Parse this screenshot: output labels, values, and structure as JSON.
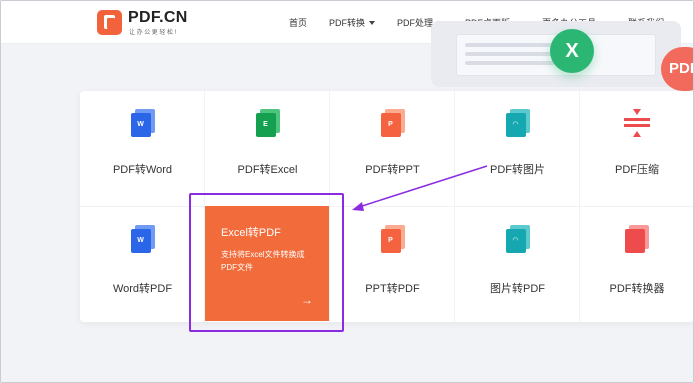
{
  "header": {
    "logo_title": "PDF.CN",
    "logo_subtitle": "让办公更轻松!",
    "nav": [
      {
        "label": "首页",
        "dropdown": false
      },
      {
        "label": "PDF转换",
        "dropdown": true
      },
      {
        "label": "PDF处理",
        "dropdown": true
      },
      {
        "label": "PDF桌面版",
        "dropdown": true
      },
      {
        "label": "更多办公工具",
        "dropdown": true
      },
      {
        "label": "联系我们",
        "dropdown": false
      }
    ]
  },
  "hero": {
    "excel_badge": "X",
    "pdf_badge": "PDF"
  },
  "tools": {
    "row1": [
      {
        "label": "PDF转Word",
        "icon": "word-file-icon",
        "glyph": "W"
      },
      {
        "label": "PDF转Excel",
        "icon": "excel-file-icon",
        "glyph": "E"
      },
      {
        "label": "PDF转PPT",
        "icon": "ppt-file-icon",
        "glyph": "P"
      },
      {
        "label": "PDF转图片",
        "icon": "image-file-icon",
        "glyph": "◠"
      },
      {
        "label": "PDF压缩",
        "icon": "compress-icon",
        "glyph": ""
      }
    ],
    "row2": [
      {
        "label": "Word转PDF",
        "icon": "word-file-icon",
        "glyph": "W"
      },
      {
        "label": "PPT转PDF",
        "icon": "ppt-file-icon",
        "glyph": "P"
      },
      {
        "label": "图片转PDF",
        "icon": "image-file-icon",
        "glyph": "◠"
      },
      {
        "label": "PDF转换器",
        "icon": "converter-file-icon",
        "glyph": ""
      }
    ],
    "featured": {
      "title": "Excel转PDF",
      "description": "支持将Excel文件转换成PDF文件",
      "arrow": "→"
    }
  },
  "colors": {
    "accent": "#f26b3a",
    "annotation": "#8a2be2",
    "word": "#2b66e8",
    "excel": "#15a04f",
    "ppt": "#f5623f",
    "image": "#16a8b0",
    "convert": "#ee4c4c"
  }
}
